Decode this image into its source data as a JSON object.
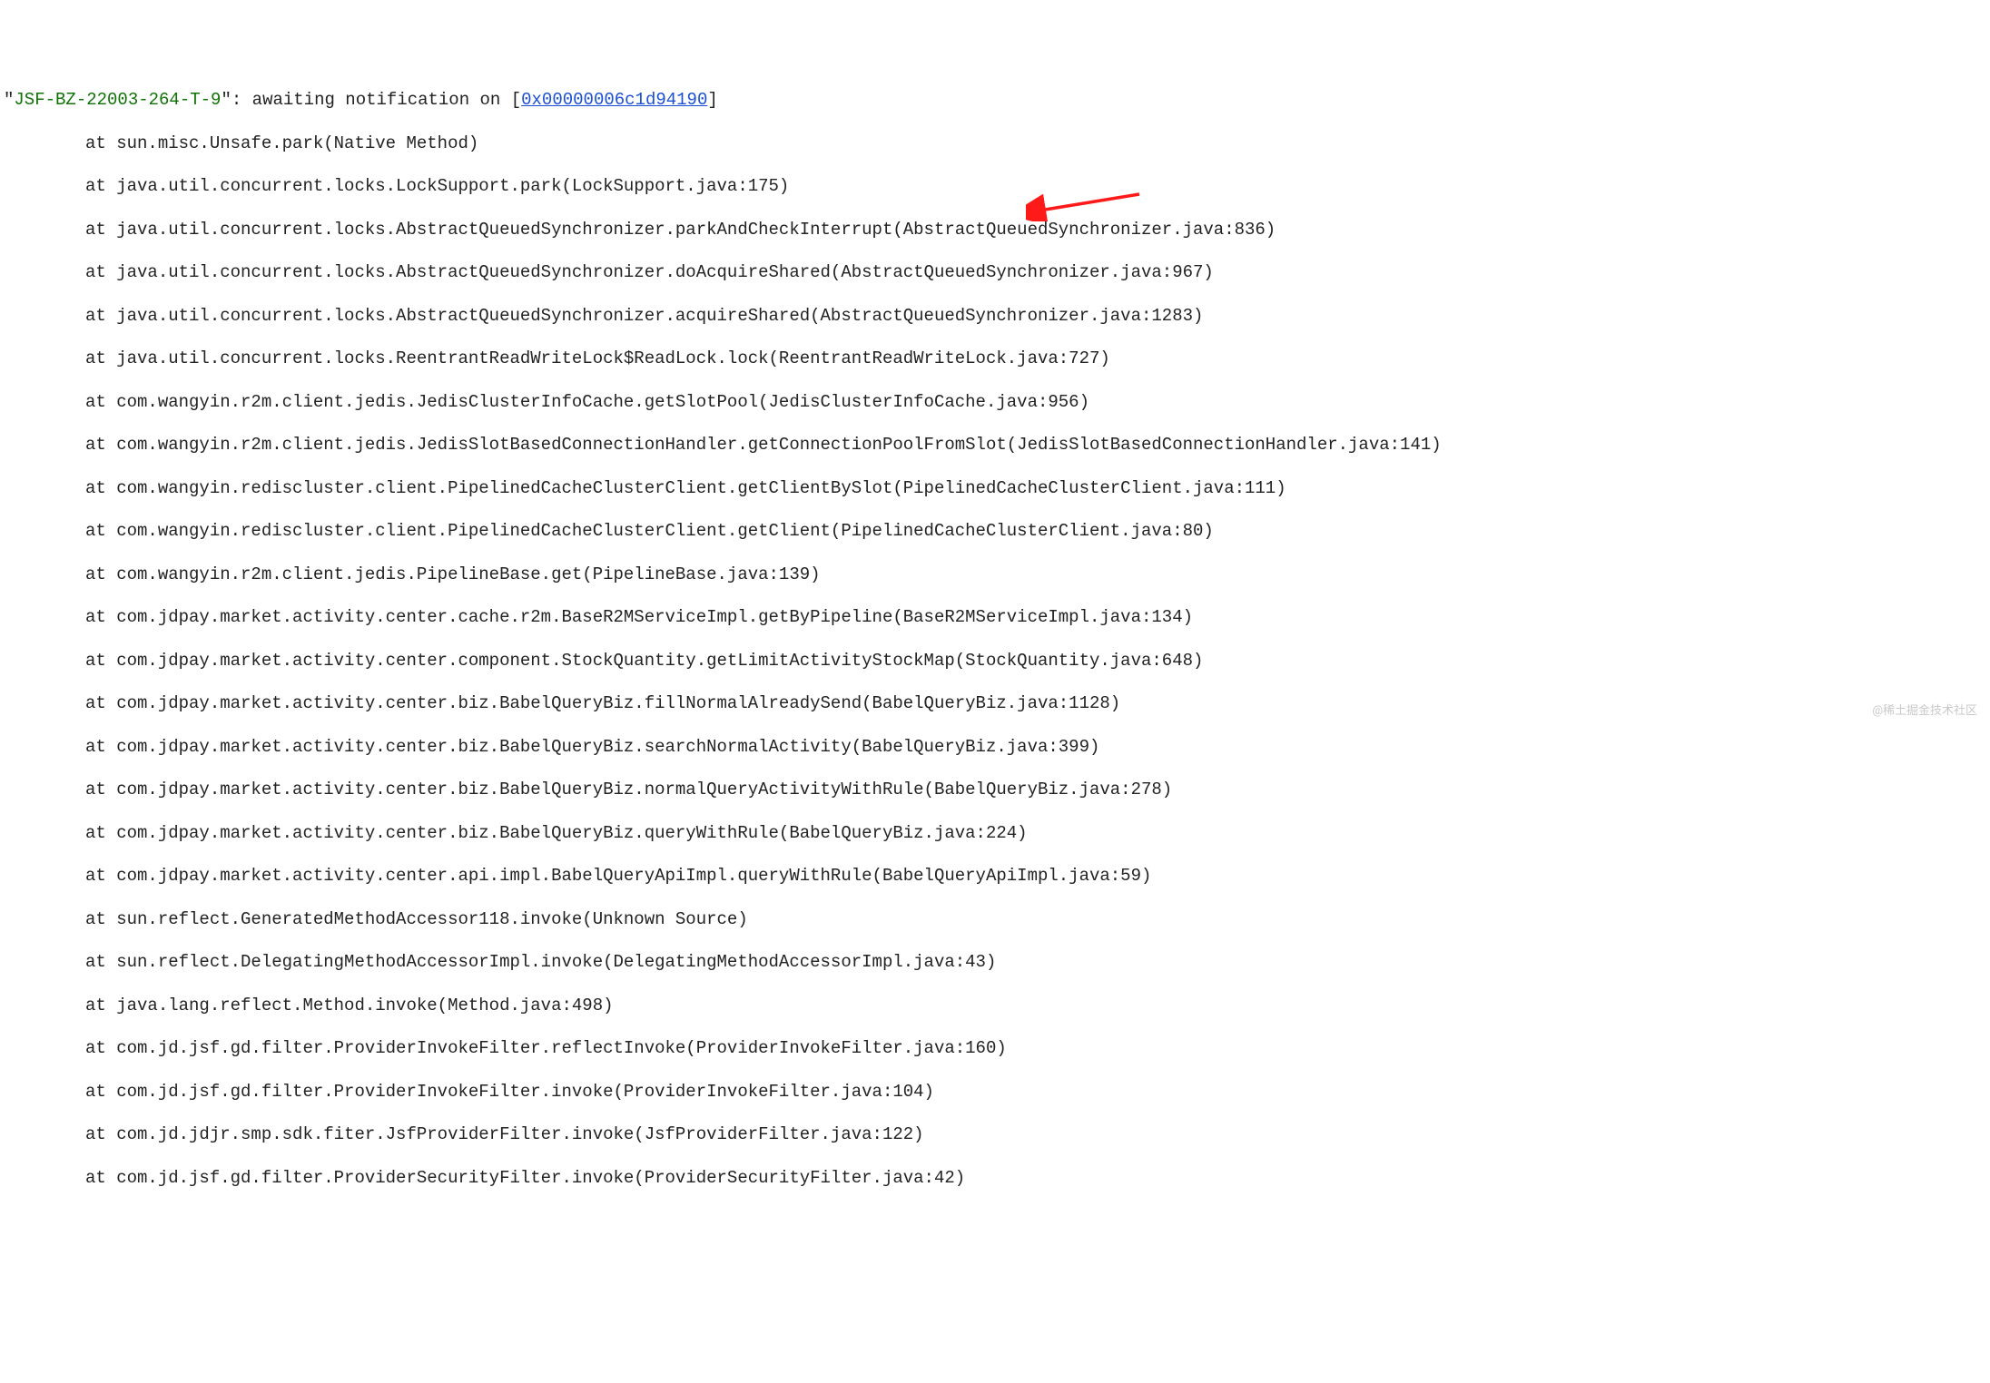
{
  "header": {
    "quote_open": "\"",
    "thread_name": "JSF-BZ-22003-264-T-9",
    "quote_close": "\": ",
    "status_text": "awaiting notification on [",
    "address": "0x00000006c1d94190",
    "close_bracket": "]"
  },
  "frames": [
    "at sun.misc.Unsafe.park(Native Method)",
    "at java.util.concurrent.locks.LockSupport.park(LockSupport.java:175)",
    "at java.util.concurrent.locks.AbstractQueuedSynchronizer.parkAndCheckInterrupt(AbstractQueuedSynchronizer.java:836)",
    "at java.util.concurrent.locks.AbstractQueuedSynchronizer.doAcquireShared(AbstractQueuedSynchronizer.java:967)",
    "at java.util.concurrent.locks.AbstractQueuedSynchronizer.acquireShared(AbstractQueuedSynchronizer.java:1283)",
    "at java.util.concurrent.locks.ReentrantReadWriteLock$ReadLock.lock(ReentrantReadWriteLock.java:727)",
    "at com.wangyin.r2m.client.jedis.JedisClusterInfoCache.getSlotPool(JedisClusterInfoCache.java:956)",
    "at com.wangyin.r2m.client.jedis.JedisSlotBasedConnectionHandler.getConnectionPoolFromSlot(JedisSlotBasedConnectionHandler.java:141)",
    "at com.wangyin.rediscluster.client.PipelinedCacheClusterClient.getClientBySlot(PipelinedCacheClusterClient.java:111)",
    "at com.wangyin.rediscluster.client.PipelinedCacheClusterClient.getClient(PipelinedCacheClusterClient.java:80)",
    "at com.wangyin.r2m.client.jedis.PipelineBase.get(PipelineBase.java:139)",
    "at com.jdpay.market.activity.center.cache.r2m.BaseR2MServiceImpl.getByPipeline(BaseR2MServiceImpl.java:134)",
    "at com.jdpay.market.activity.center.component.StockQuantity.getLimitActivityStockMap(StockQuantity.java:648)",
    "at com.jdpay.market.activity.center.biz.BabelQueryBiz.fillNormalAlreadySend(BabelQueryBiz.java:1128)",
    "at com.jdpay.market.activity.center.biz.BabelQueryBiz.searchNormalActivity(BabelQueryBiz.java:399)",
    "at com.jdpay.market.activity.center.biz.BabelQueryBiz.normalQueryActivityWithRule(BabelQueryBiz.java:278)",
    "at com.jdpay.market.activity.center.biz.BabelQueryBiz.queryWithRule(BabelQueryBiz.java:224)",
    "at com.jdpay.market.activity.center.api.impl.BabelQueryApiImpl.queryWithRule(BabelQueryApiImpl.java:59)",
    "at sun.reflect.GeneratedMethodAccessor118.invoke(Unknown Source)",
    "at sun.reflect.DelegatingMethodAccessorImpl.invoke(DelegatingMethodAccessorImpl.java:43)",
    "at java.lang.reflect.Method.invoke(Method.java:498)",
    "at com.jd.jsf.gd.filter.ProviderInvokeFilter.reflectInvoke(ProviderInvokeFilter.java:160)",
    "at com.jd.jsf.gd.filter.ProviderInvokeFilter.invoke(ProviderInvokeFilter.java:104)",
    "at com.jd.jdjr.smp.sdk.fiter.JsfProviderFilter.invoke(JsfProviderFilter.java:122)",
    "at com.jd.jsf.gd.filter.ProviderSecurityFilter.invoke(ProviderSecurityFilter.java:42)"
  ],
  "annotation": {
    "highlight_frame_index": 6,
    "arrow_color": "#ff1a1a"
  },
  "watermark": "@稀土掘金技术社区"
}
